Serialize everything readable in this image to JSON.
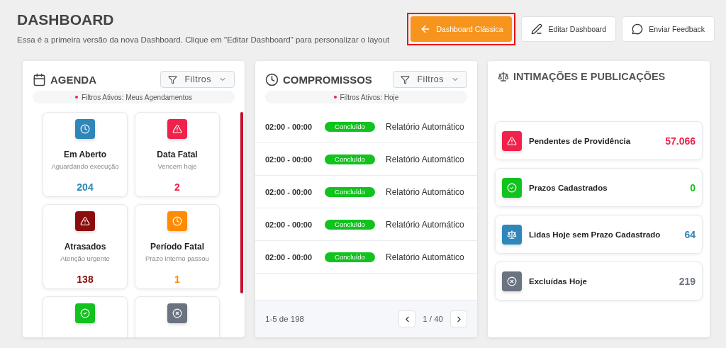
{
  "header": {
    "title": "DASHBOARD",
    "subtitle": "Essa é a primeira versão da nova Dashboard. Clique em \"Editar Dashboard\" para personalizar o layout"
  },
  "actions": [
    {
      "kind": "back",
      "label": "Dashboard Clássica",
      "primary": true,
      "highlighted": true
    },
    {
      "kind": "edit",
      "label": "Editar Dashboard",
      "primary": false,
      "highlighted": false
    },
    {
      "kind": "feedback",
      "label": "Enviar Feedback",
      "primary": false,
      "highlighted": false
    }
  ],
  "agenda": {
    "title": "AGENDA",
    "filter_button": "Filtros",
    "active_filters": "Filtros Ativos: Meus Agendamentos",
    "tiles": [
      {
        "kind": "clock",
        "color": "#2e86b9",
        "title": "Em Aberto",
        "subtitle": "Aguardando execução",
        "count": "204"
      },
      {
        "kind": "alert",
        "color": "#f0214a",
        "title": "Data Fatal",
        "subtitle": "Vencem hoje",
        "count": "2"
      },
      {
        "kind": "alert",
        "color": "#8b0d0d",
        "title": "Atrasados",
        "subtitle": "Atenção urgente",
        "count": "138"
      },
      {
        "kind": "clock",
        "color": "#ff8c00",
        "title": "Período Fatal",
        "subtitle": "Prazo interno passou",
        "count": "1"
      },
      {
        "kind": "check",
        "color": "#12c21e"
      },
      {
        "kind": "x",
        "color": "#6b7280"
      }
    ]
  },
  "compromissos": {
    "title": "COMPROMISSOS",
    "filter_button": "Filtros",
    "active_filters": "Filtros Ativos: Hoje",
    "rows": [
      {
        "time": "02:00 - 00:00",
        "status": "Concluído",
        "title": "Relatório Automático"
      },
      {
        "time": "02:00 - 00:00",
        "status": "Concluído",
        "title": "Relatório Automático"
      },
      {
        "time": "02:00 - 00:00",
        "status": "Concluído",
        "title": "Relatório Automático"
      },
      {
        "time": "02:00 - 00:00",
        "status": "Concluído",
        "title": "Relatório Automático"
      },
      {
        "time": "02:00 - 00:00",
        "status": "Concluído",
        "title": "Relatório Automático"
      }
    ],
    "range": "1-5 de 198",
    "page": "1 / 40"
  },
  "intimacoes": {
    "title": "INTIMAÇÕES E PUBLICAÇÕES",
    "items": [
      {
        "kind": "alert",
        "color": "#f0214a",
        "label": "Pendentes de Providência",
        "count": "57.066"
      },
      {
        "kind": "check",
        "color": "#12c21e",
        "label": "Prazos Cadastrados",
        "count": "0"
      },
      {
        "kind": "scale",
        "color": "#2e86b9",
        "label": "Lidas Hoje sem Prazo Cadastrado",
        "count": "64"
      },
      {
        "kind": "x",
        "color": "#6b7280",
        "label": "Excluídas Hoje",
        "count": "219"
      }
    ]
  }
}
